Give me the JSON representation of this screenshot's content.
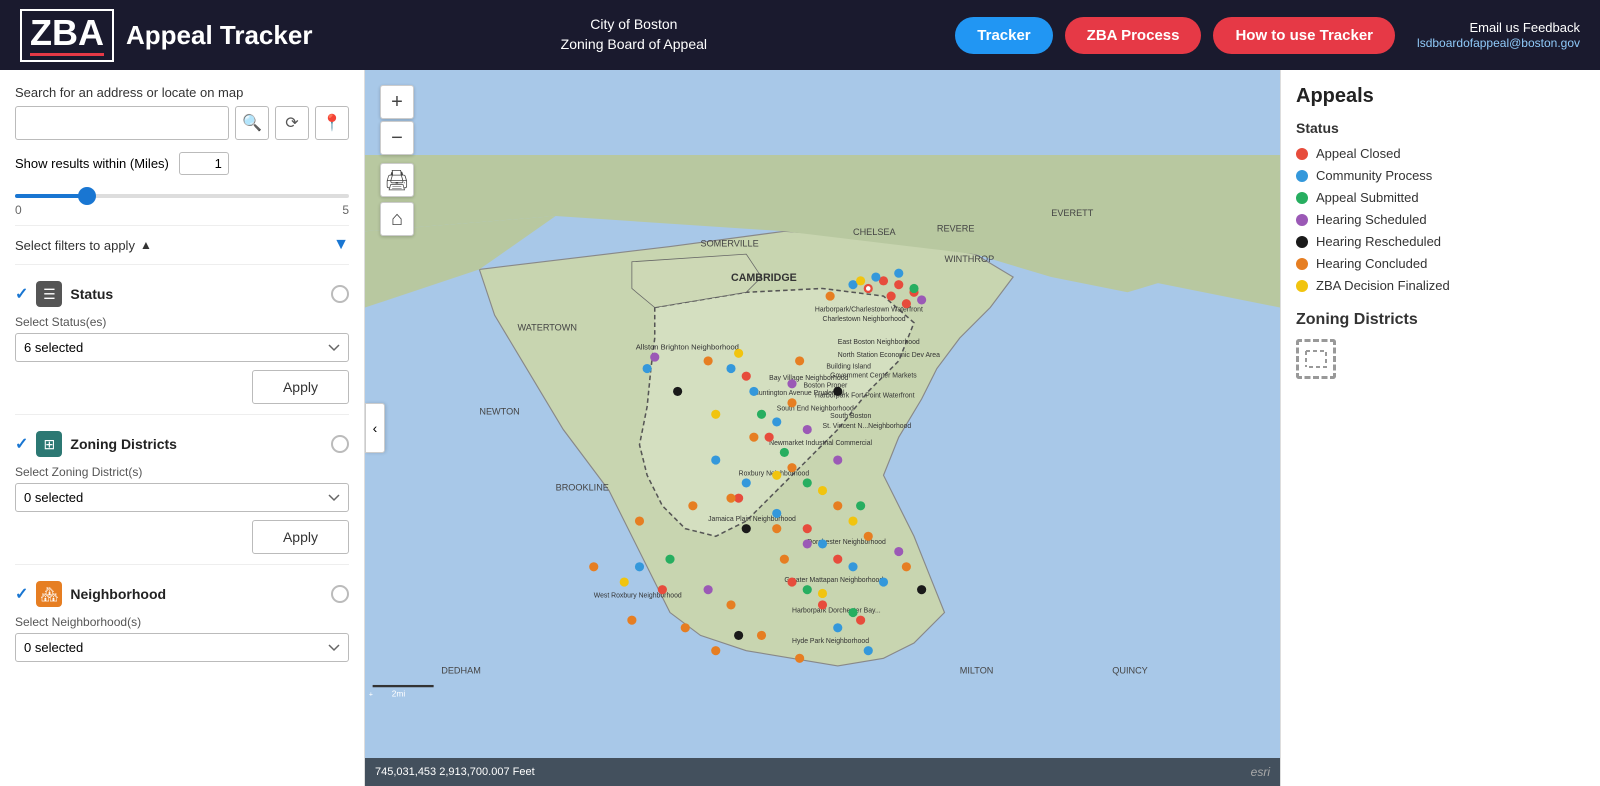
{
  "header": {
    "logo_text": "ZBA",
    "app_title": "Appeal Tracker",
    "center_line1": "City of Boston",
    "center_line2": "Zoning Board of Appeal",
    "nav_tracker": "Tracker",
    "nav_zba_process": "ZBA Process",
    "nav_how_to": "How to use Tracker",
    "email_label": "Email us Feedback",
    "email_address": "lsdboardofappeal@boston.gov"
  },
  "sidebar": {
    "search_label": "Search for an address or locate on map",
    "search_placeholder": "",
    "miles_label": "Show results within (Miles)",
    "miles_value": "1",
    "range_min": "0",
    "range_max": "5",
    "filters_label": "Select filters to apply",
    "filter_icon_label": "Filter",
    "status_filter": {
      "title": "Status",
      "sublabel": "Select Status(es)",
      "selected_value": "6 selected",
      "apply_label": "Apply"
    },
    "zoning_filter": {
      "title": "Zoning Districts",
      "sublabel": "Select Zoning District(s)",
      "selected_value": "0 selected",
      "apply_label": "Apply"
    },
    "neighborhood_filter": {
      "title": "Neighborhood",
      "sublabel": "Select Neighborhood(s)",
      "selected_value": "0 selected"
    }
  },
  "map": {
    "zoom_in": "+",
    "zoom_out": "−",
    "print_icon": "🖨",
    "home_icon": "⌂",
    "toggle_icon": "‹",
    "coordinates": "745,031,453 2,913,700.007 Feet",
    "scale": "2mi",
    "esri_label": "esri"
  },
  "legend": {
    "title": "Appeals",
    "status_title": "Status",
    "items": [
      {
        "label": "Appeal Closed",
        "color": "#e74c3c"
      },
      {
        "label": "Community Process",
        "color": "#3498db"
      },
      {
        "label": "Appeal Submitted",
        "color": "#27ae60"
      },
      {
        "label": "Hearing Scheduled",
        "color": "#9b59b6"
      },
      {
        "label": "Hearing Rescheduled",
        "color": "#1a1a1a"
      },
      {
        "label": "Hearing Concluded",
        "color": "#e67e22"
      },
      {
        "label": "ZBA Decision Finalized",
        "color": "#f1c40f"
      }
    ],
    "zoning_title": "Zoning Districts"
  }
}
